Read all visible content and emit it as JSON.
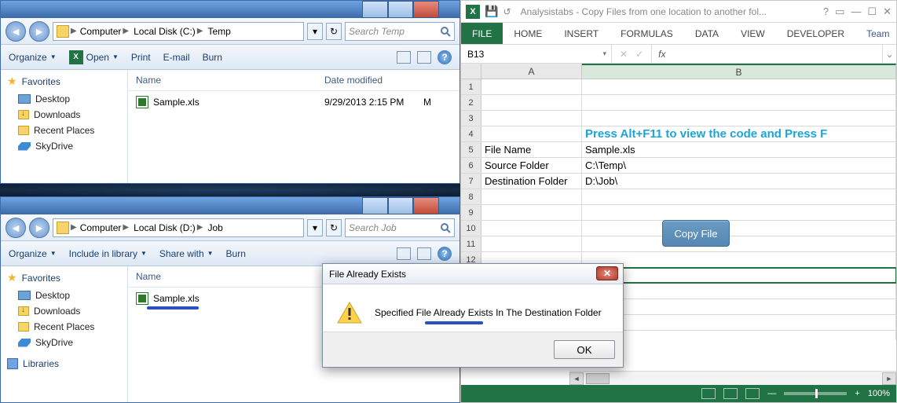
{
  "explorer1": {
    "breadcrumb": [
      "Computer",
      "Local Disk (C:)",
      "Temp"
    ],
    "search_placeholder": "Search Temp",
    "toolbar": {
      "organize": "Organize",
      "open": "Open",
      "print": "Print",
      "email": "E-mail",
      "burn": "Burn"
    },
    "columns": {
      "name": "Name",
      "date": "Date modified"
    },
    "favorites_label": "Favorites",
    "favorites": [
      "Desktop",
      "Downloads",
      "Recent Places",
      "SkyDrive"
    ],
    "file": {
      "name": "Sample.xls",
      "date": "9/29/2013 2:15 PM",
      "type_initial": "M"
    }
  },
  "explorer2": {
    "breadcrumb": [
      "Computer",
      "Local Disk (D:)",
      "Job"
    ],
    "search_placeholder": "Search Job",
    "toolbar": {
      "organize": "Organize",
      "include": "Include in library",
      "share": "Share with",
      "burn": "Burn"
    },
    "columns": {
      "name": "Name"
    },
    "favorites_label": "Favorites",
    "favorites": [
      "Desktop",
      "Downloads",
      "Recent Places",
      "SkyDrive"
    ],
    "libraries_label": "Libraries",
    "file": {
      "name": "Sample.xls"
    }
  },
  "dialog": {
    "title": "File Already Exists",
    "message": "Specified File Already Exists In The Destination Folder",
    "ok": "OK"
  },
  "excel": {
    "title": "Analysistabs - Copy Files from one location to another fol...",
    "tabs": {
      "file": "FILE",
      "home": "HOME",
      "insert": "INSERT",
      "formulas": "FORMULAS",
      "data": "DATA",
      "view": "VIEW",
      "developer": "DEVELOPER",
      "team": "Team"
    },
    "namebox": "B13",
    "fx_label": "fx",
    "col_headers": {
      "A": "A",
      "B": "B"
    },
    "rows": {
      "hint": "Press Alt+F11 to view the code and Press F",
      "r5a": "File Name",
      "r5b": "Sample.xls",
      "r6a": "Source Folder",
      "r6b": "C:\\Temp\\",
      "r7a": "Destination Folder",
      "r7b": "D:\\Job\\"
    },
    "copy_button": "Copy File",
    "zoom": "100%"
  }
}
